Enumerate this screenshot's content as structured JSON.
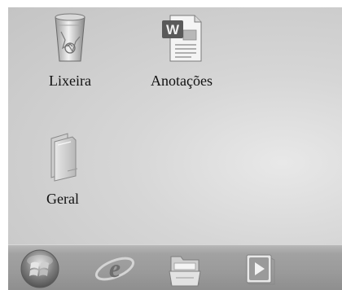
{
  "desktop": {
    "icons": [
      {
        "label": "Lixeira",
        "icon": "recycle-bin-icon"
      },
      {
        "label": "Anotações",
        "icon": "word-document-icon"
      },
      {
        "label": "Geral",
        "icon": "folder-icon"
      }
    ]
  },
  "taskbar": {
    "start_icon": "windows-start-orb-icon",
    "pinned": [
      {
        "icon": "internet-explorer-icon"
      },
      {
        "icon": "windows-explorer-icon"
      },
      {
        "icon": "media-player-icon"
      }
    ]
  }
}
